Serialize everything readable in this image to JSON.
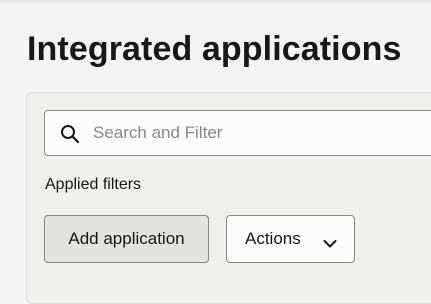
{
  "header": {
    "title": "Integrated applications"
  },
  "search": {
    "placeholder": "Search and Filter",
    "value": "",
    "icon": "search-icon"
  },
  "filters": {
    "label": "Applied filters"
  },
  "toolbar": {
    "add_label": "Add application",
    "actions_label": "Actions",
    "actions_icon": "chevron-down-icon"
  },
  "colors": {
    "background": "#f5f4f2",
    "panel": "#f1efec",
    "primary_button": "#e4e2df",
    "border": "#8a8682",
    "text": "#1a1816",
    "placeholder": "#8b8784"
  }
}
